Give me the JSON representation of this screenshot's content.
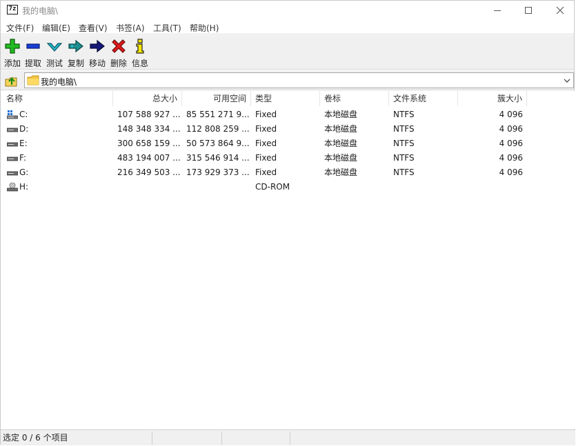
{
  "window": {
    "app_logo": "7z",
    "title": "我的电脑\\"
  },
  "menu": [
    "文件(F)",
    "编辑(E)",
    "查看(V)",
    "书签(A)",
    "工具(T)",
    "帮助(H)"
  ],
  "toolbar": {
    "add": "添加",
    "extract": "提取",
    "test": "测试",
    "copy": "复制",
    "move": "移动",
    "delete": "删除",
    "info": "信息"
  },
  "address": {
    "path": "我的电脑\\"
  },
  "columns": {
    "name": "名称",
    "total_size": "总大小",
    "free_space": "可用空间",
    "type": "类型",
    "label": "卷标",
    "file_system": "文件系统",
    "cluster_size": "簇大小"
  },
  "drives": [
    {
      "name": "C:",
      "icon": "system-drive-icon",
      "total": "107 588 927 ...",
      "free": "85 551 271 9...",
      "type": "Fixed",
      "label": "本地磁盘",
      "fs": "NTFS",
      "cluster": "4 096"
    },
    {
      "name": "D:",
      "icon": "hard-drive-icon",
      "total": "148 348 334 ...",
      "free": "112 808 259 ...",
      "type": "Fixed",
      "label": "本地磁盘",
      "fs": "NTFS",
      "cluster": "4 096"
    },
    {
      "name": "E:",
      "icon": "hard-drive-icon",
      "total": "300 658 159 ...",
      "free": "50 573 864 9...",
      "type": "Fixed",
      "label": "本地磁盘",
      "fs": "NTFS",
      "cluster": "4 096"
    },
    {
      "name": "F:",
      "icon": "hard-drive-icon",
      "total": "483 194 007 ...",
      "free": "315 546 914 ...",
      "type": "Fixed",
      "label": "本地磁盘",
      "fs": "NTFS",
      "cluster": "4 096"
    },
    {
      "name": "G:",
      "icon": "hard-drive-icon",
      "total": "216 349 503 ...",
      "free": "173 929 373 ...",
      "type": "Fixed",
      "label": "本地磁盘",
      "fs": "NTFS",
      "cluster": "4 096"
    },
    {
      "name": "H:",
      "icon": "cd-drive-icon",
      "total": "",
      "free": "",
      "type": "CD-ROM",
      "label": "",
      "fs": "",
      "cluster": ""
    }
  ],
  "status": {
    "selection": "选定 0 / 6 个项目"
  },
  "colors": {
    "toolbar_bg": "#f0f0f0",
    "add_green": "#22bb22",
    "extract_blue": "#1a3fd6",
    "test_teal": "#27b5c8",
    "copy_teal": "#1e8f8f",
    "move_navy": "#16197a",
    "delete_red": "#e01b1b",
    "info_yellow": "#f5e600"
  }
}
